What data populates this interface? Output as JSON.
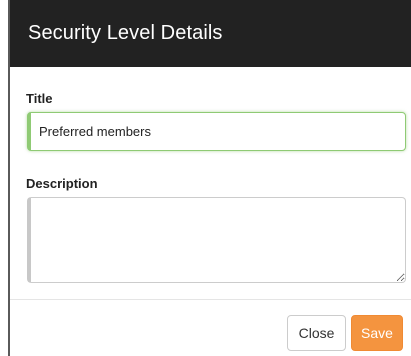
{
  "dialog": {
    "title": "Security Level Details"
  },
  "form": {
    "title_label": "Title",
    "title_value": "Preferred members",
    "description_label": "Description",
    "description_value": ""
  },
  "footer": {
    "close_label": "Close",
    "save_label": "Save"
  },
  "colors": {
    "header_bg": "#222222",
    "focus_border": "#8fca74",
    "save_button": "#f4943f"
  }
}
